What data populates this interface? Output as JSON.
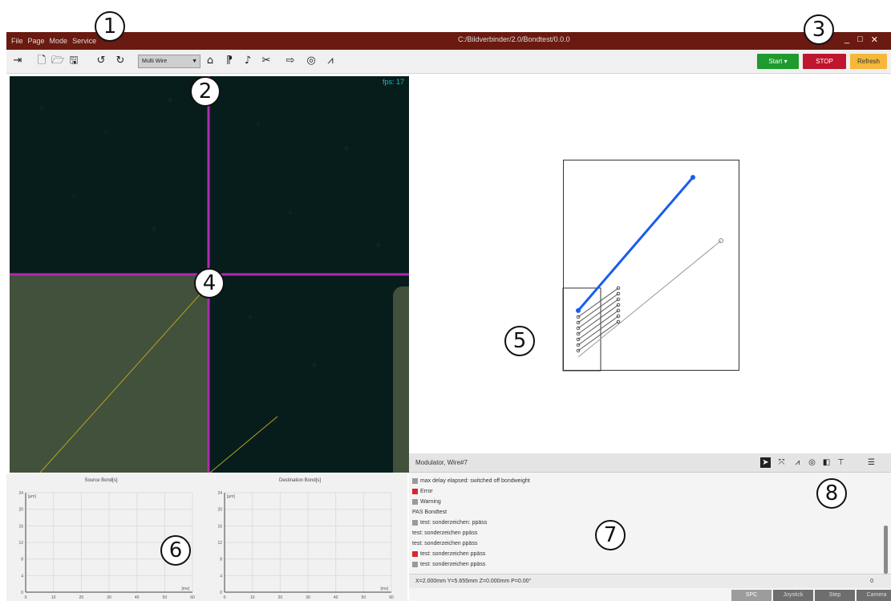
{
  "callouts": [
    "1",
    "2",
    "3",
    "4",
    "5",
    "6",
    "7",
    "8"
  ],
  "titlebar": {
    "menu": [
      "File",
      "Page",
      "Mode",
      "Service"
    ],
    "path": "C:/Bildverbinder/2.0/Bondtest/0.0.0",
    "controls": [
      "_",
      "□",
      "✕"
    ]
  },
  "toolbar": {
    "mode_value": "Multi Wire",
    "start_label": "Start",
    "stop_label": "STOP",
    "refresh_label": "Refresh"
  },
  "camera": {
    "fps": "fps: 17"
  },
  "plots": {
    "left_title": "Source Bond[s]",
    "right_title": "Destination Bond[s]",
    "y_unit": "[µm]",
    "x_unit": "[ms]",
    "y_ticks": [
      "24",
      "20",
      "16",
      "12",
      "8",
      "4",
      "0"
    ],
    "x_ticks": [
      "0",
      "10",
      "20",
      "30",
      "40",
      "50",
      "60"
    ]
  },
  "log": {
    "title": "Modulator, Wire#7",
    "rows": [
      {
        "text": "max delay elapsed: switched off bondweight",
        "level": "info"
      },
      {
        "text": "Error",
        "level": "error"
      },
      {
        "text": "Warning",
        "level": "info"
      },
      {
        "text": "PAS Bondtest",
        "level": "none"
      },
      {
        "text": "test: sonderzeichen: ppäss",
        "level": "info"
      },
      {
        "text": "test: sonderzeichen ppäss",
        "level": "none"
      },
      {
        "text": "test: sonderzeichen ppäss",
        "level": "none"
      },
      {
        "text": "test: sonderzeichen ppäss",
        "level": "error"
      },
      {
        "text": "test: sonderzeichen ppäss",
        "level": "info"
      }
    ],
    "status": "X=2.000mm Y=5.655mm Z=0.000mm P=0.00°",
    "status_zero": "0",
    "tabs": [
      "SPC",
      "Joystick",
      "Step",
      "Camera"
    ],
    "colors": {
      "error": "#d9262c",
      "info": "#9a9a9a"
    }
  }
}
